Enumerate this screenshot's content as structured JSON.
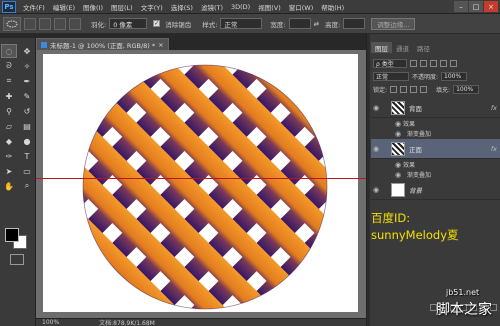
{
  "app": {
    "logo": "Ps"
  },
  "menu": [
    "文件(F)",
    "编辑(E)",
    "图像(I)",
    "图层(L)",
    "文字(Y)",
    "选择(S)",
    "滤镜(T)",
    "3D(D)",
    "视图(V)",
    "窗口(W)",
    "帮助(H)"
  ],
  "window_controls": {
    "minimize": "–",
    "maximize": "□",
    "close": "×"
  },
  "options": {
    "feather_label": "羽化:",
    "feather_value": "0 像素",
    "antialias_label": "消除锯齿",
    "style_label": "样式:",
    "style_value": "正常",
    "width_label": "宽度:",
    "height_label": "高度:",
    "refine_edge": "调整边缘..."
  },
  "document": {
    "tab_title": "未标题-1 @ 100% (正面, RGB/8) *",
    "zoom": "100%",
    "doc_info": "文档:878.9K/1.68M"
  },
  "panel": {
    "tabs": [
      "图层",
      "通道",
      "路径"
    ],
    "kind_filter": "ρ 类型",
    "blend_mode": "正常",
    "opacity_label": "不透明度:",
    "opacity_value": "100%",
    "lock_label": "锁定:",
    "fill_label": "填充:",
    "fill_value": "100%",
    "layers": [
      {
        "name": "背面",
        "fx": "fx",
        "effects_label": "效果",
        "effect": "渐变叠加"
      },
      {
        "name": "正面",
        "fx": "fx",
        "effects_label": "效果",
        "effect": "渐变叠加"
      },
      {
        "name": "背景"
      }
    ]
  },
  "watermark": {
    "line1": "百度ID:",
    "line2": "sunnyMelody夏"
  },
  "site": {
    "url": "jb51.net",
    "name": "脚本之家"
  },
  "colors": {
    "guide": "#c0141c",
    "orange": "#f08a1e",
    "purple": "#3a1a6e",
    "watermark": "#f2e000",
    "selected_layer": "#5a6478"
  }
}
